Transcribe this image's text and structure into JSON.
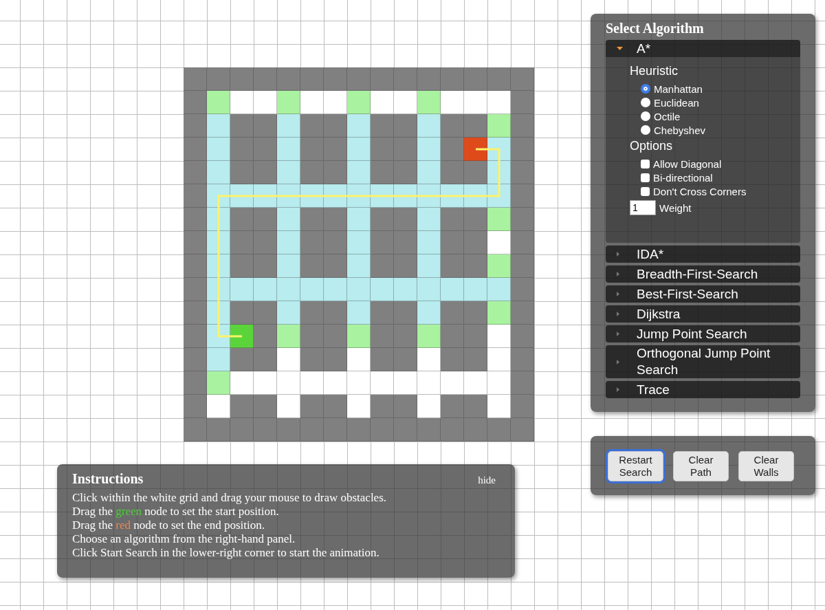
{
  "maze": {
    "rows": [
      [
        {
          "kind": "wall"
        },
        {
          "kind": "wall"
        },
        {
          "kind": "wall"
        },
        {
          "kind": "wall"
        },
        {
          "kind": "wall"
        },
        {
          "kind": "wall"
        },
        {
          "kind": "wall"
        },
        {
          "kind": "wall"
        },
        {
          "kind": "wall"
        },
        {
          "kind": "wall"
        },
        {
          "kind": "wall"
        },
        {
          "kind": "wall"
        },
        {
          "kind": "wall"
        },
        {
          "kind": "wall"
        },
        {
          "kind": "wall"
        }
      ],
      [
        {
          "kind": "wall"
        },
        {
          "kind": "open"
        },
        {
          "kind": "free"
        },
        {
          "kind": "free"
        },
        {
          "kind": "open"
        },
        {
          "kind": "free"
        },
        {
          "kind": "free"
        },
        {
          "kind": "open"
        },
        {
          "kind": "free"
        },
        {
          "kind": "free"
        },
        {
          "kind": "open"
        },
        {
          "kind": "free"
        },
        {
          "kind": "free"
        },
        {
          "kind": "free"
        },
        {
          "kind": "wall"
        }
      ],
      [
        {
          "kind": "wall"
        },
        {
          "kind": "closed"
        },
        {
          "kind": "wall"
        },
        {
          "kind": "wall"
        },
        {
          "kind": "closed"
        },
        {
          "kind": "wall"
        },
        {
          "kind": "wall"
        },
        {
          "kind": "closed"
        },
        {
          "kind": "wall"
        },
        {
          "kind": "wall"
        },
        {
          "kind": "closed"
        },
        {
          "kind": "wall"
        },
        {
          "kind": "wall"
        },
        {
          "kind": "open"
        },
        {
          "kind": "wall"
        }
      ],
      [
        {
          "kind": "wall"
        },
        {
          "kind": "closed"
        },
        {
          "kind": "wall"
        },
        {
          "kind": "wall"
        },
        {
          "kind": "closed"
        },
        {
          "kind": "wall"
        },
        {
          "kind": "wall"
        },
        {
          "kind": "closed"
        },
        {
          "kind": "wall"
        },
        {
          "kind": "wall"
        },
        {
          "kind": "closed"
        },
        {
          "kind": "wall"
        },
        {
          "kind": "end"
        },
        {
          "kind": "path"
        },
        {
          "kind": "wall"
        }
      ],
      [
        {
          "kind": "wall"
        },
        {
          "kind": "closed"
        },
        {
          "kind": "wall"
        },
        {
          "kind": "wall"
        },
        {
          "kind": "closed"
        },
        {
          "kind": "wall"
        },
        {
          "kind": "wall"
        },
        {
          "kind": "closed"
        },
        {
          "kind": "wall"
        },
        {
          "kind": "wall"
        },
        {
          "kind": "closed"
        },
        {
          "kind": "wall"
        },
        {
          "kind": "wall"
        },
        {
          "kind": "path"
        },
        {
          "kind": "wall"
        }
      ],
      [
        {
          "kind": "wall"
        },
        {
          "kind": "path"
        },
        {
          "kind": "path"
        },
        {
          "kind": "path"
        },
        {
          "kind": "path"
        },
        {
          "kind": "path"
        },
        {
          "kind": "path"
        },
        {
          "kind": "path"
        },
        {
          "kind": "path"
        },
        {
          "kind": "path"
        },
        {
          "kind": "path"
        },
        {
          "kind": "path"
        },
        {
          "kind": "path"
        },
        {
          "kind": "path"
        },
        {
          "kind": "wall"
        }
      ],
      [
        {
          "kind": "wall"
        },
        {
          "kind": "path"
        },
        {
          "kind": "wall"
        },
        {
          "kind": "wall"
        },
        {
          "kind": "closed"
        },
        {
          "kind": "wall"
        },
        {
          "kind": "wall"
        },
        {
          "kind": "closed"
        },
        {
          "kind": "wall"
        },
        {
          "kind": "wall"
        },
        {
          "kind": "closed"
        },
        {
          "kind": "wall"
        },
        {
          "kind": "wall"
        },
        {
          "kind": "open"
        },
        {
          "kind": "wall"
        }
      ],
      [
        {
          "kind": "wall"
        },
        {
          "kind": "path"
        },
        {
          "kind": "wall"
        },
        {
          "kind": "wall"
        },
        {
          "kind": "closed"
        },
        {
          "kind": "wall"
        },
        {
          "kind": "wall"
        },
        {
          "kind": "closed"
        },
        {
          "kind": "wall"
        },
        {
          "kind": "wall"
        },
        {
          "kind": "closed"
        },
        {
          "kind": "wall"
        },
        {
          "kind": "wall"
        },
        {
          "kind": "free"
        },
        {
          "kind": "wall"
        }
      ],
      [
        {
          "kind": "wall"
        },
        {
          "kind": "path"
        },
        {
          "kind": "wall"
        },
        {
          "kind": "wall"
        },
        {
          "kind": "closed"
        },
        {
          "kind": "wall"
        },
        {
          "kind": "wall"
        },
        {
          "kind": "closed"
        },
        {
          "kind": "wall"
        },
        {
          "kind": "wall"
        },
        {
          "kind": "closed"
        },
        {
          "kind": "wall"
        },
        {
          "kind": "wall"
        },
        {
          "kind": "open"
        },
        {
          "kind": "wall"
        }
      ],
      [
        {
          "kind": "wall"
        },
        {
          "kind": "path"
        },
        {
          "kind": "closed"
        },
        {
          "kind": "closed"
        },
        {
          "kind": "closed"
        },
        {
          "kind": "closed"
        },
        {
          "kind": "closed"
        },
        {
          "kind": "closed"
        },
        {
          "kind": "closed"
        },
        {
          "kind": "closed"
        },
        {
          "kind": "closed"
        },
        {
          "kind": "closed"
        },
        {
          "kind": "closed"
        },
        {
          "kind": "closed"
        },
        {
          "kind": "wall"
        }
      ],
      [
        {
          "kind": "wall"
        },
        {
          "kind": "path"
        },
        {
          "kind": "wall"
        },
        {
          "kind": "wall"
        },
        {
          "kind": "closed"
        },
        {
          "kind": "wall"
        },
        {
          "kind": "wall"
        },
        {
          "kind": "closed"
        },
        {
          "kind": "wall"
        },
        {
          "kind": "wall"
        },
        {
          "kind": "closed"
        },
        {
          "kind": "wall"
        },
        {
          "kind": "wall"
        },
        {
          "kind": "open"
        },
        {
          "kind": "wall"
        }
      ],
      [
        {
          "kind": "wall"
        },
        {
          "kind": "path"
        },
        {
          "kind": "start"
        },
        {
          "kind": "wall"
        },
        {
          "kind": "open"
        },
        {
          "kind": "wall"
        },
        {
          "kind": "wall"
        },
        {
          "kind": "open"
        },
        {
          "kind": "wall"
        },
        {
          "kind": "wall"
        },
        {
          "kind": "open"
        },
        {
          "kind": "wall"
        },
        {
          "kind": "wall"
        },
        {
          "kind": "free"
        },
        {
          "kind": "wall"
        }
      ],
      [
        {
          "kind": "wall"
        },
        {
          "kind": "closed"
        },
        {
          "kind": "wall"
        },
        {
          "kind": "wall"
        },
        {
          "kind": "free"
        },
        {
          "kind": "wall"
        },
        {
          "kind": "wall"
        },
        {
          "kind": "free"
        },
        {
          "kind": "wall"
        },
        {
          "kind": "wall"
        },
        {
          "kind": "free"
        },
        {
          "kind": "wall"
        },
        {
          "kind": "wall"
        },
        {
          "kind": "free"
        },
        {
          "kind": "wall"
        }
      ],
      [
        {
          "kind": "wall"
        },
        {
          "kind": "open"
        },
        {
          "kind": "free"
        },
        {
          "kind": "free"
        },
        {
          "kind": "free"
        },
        {
          "kind": "free"
        },
        {
          "kind": "free"
        },
        {
          "kind": "free"
        },
        {
          "kind": "free"
        },
        {
          "kind": "free"
        },
        {
          "kind": "free"
        },
        {
          "kind": "free"
        },
        {
          "kind": "free"
        },
        {
          "kind": "free"
        },
        {
          "kind": "wall"
        }
      ],
      [
        {
          "kind": "wall"
        },
        {
          "kind": "free"
        },
        {
          "kind": "wall"
        },
        {
          "kind": "wall"
        },
        {
          "kind": "free"
        },
        {
          "kind": "wall"
        },
        {
          "kind": "wall"
        },
        {
          "kind": "free"
        },
        {
          "kind": "wall"
        },
        {
          "kind": "wall"
        },
        {
          "kind": "free"
        },
        {
          "kind": "wall"
        },
        {
          "kind": "wall"
        },
        {
          "kind": "free"
        },
        {
          "kind": "wall"
        }
      ],
      [
        {
          "kind": "wall"
        },
        {
          "kind": "wall"
        },
        {
          "kind": "wall"
        },
        {
          "kind": "wall"
        },
        {
          "kind": "wall"
        },
        {
          "kind": "wall"
        },
        {
          "kind": "wall"
        },
        {
          "kind": "wall"
        },
        {
          "kind": "wall"
        },
        {
          "kind": "wall"
        },
        {
          "kind": "wall"
        },
        {
          "kind": "wall"
        },
        {
          "kind": "wall"
        },
        {
          "kind": "wall"
        },
        {
          "kind": "wall"
        }
      ]
    ]
  },
  "algorithm_panel": {
    "title": "Select Algorithm",
    "algorithms": [
      {
        "name": "A*",
        "expanded": true,
        "heuristic_label": "Heuristic",
        "heuristics": [
          {
            "label": "Manhattan",
            "selected": true
          },
          {
            "label": "Euclidean",
            "selected": false
          },
          {
            "label": "Octile",
            "selected": false
          },
          {
            "label": "Chebyshev",
            "selected": false
          }
        ],
        "options_label": "Options",
        "options": [
          {
            "label": "Allow Diagonal",
            "checked": false
          },
          {
            "label": "Bi-directional",
            "checked": false
          },
          {
            "label": "Don't Cross Corners",
            "checked": false
          }
        ],
        "weight": {
          "value": "1",
          "label": "Weight"
        }
      },
      {
        "name": "IDA*",
        "expanded": false
      },
      {
        "name": "Breadth-First-Search",
        "expanded": false
      },
      {
        "name": "Best-First-Search",
        "expanded": false
      },
      {
        "name": "Dijkstra",
        "expanded": false
      },
      {
        "name": "Jump Point Search",
        "expanded": false
      },
      {
        "name": "Orthogonal Jump Point Search",
        "expanded": false
      },
      {
        "name": "Trace",
        "expanded": false
      }
    ]
  },
  "control_buttons": [
    {
      "label": "Restart Search",
      "focused": true
    },
    {
      "label": "Clear Path",
      "focused": false
    },
    {
      "label": "Clear Walls",
      "focused": false
    }
  ],
  "instructions": {
    "title": "Instructions",
    "hide_link": "hide",
    "lines": [
      {
        "parts": [
          {
            "text": "Click within the white grid and drag your mouse to draw obstacles."
          }
        ]
      },
      {
        "parts": [
          {
            "text": "Drag the "
          },
          {
            "text": "green",
            "color": "#4fd13a"
          },
          {
            "text": " node to set the start position."
          }
        ]
      },
      {
        "parts": [
          {
            "text": "Drag the "
          },
          {
            "text": "red",
            "color": "#e8875a"
          },
          {
            "text": " node to set the end position."
          }
        ]
      },
      {
        "parts": [
          {
            "text": "Choose an algorithm from the right-hand panel."
          }
        ]
      },
      {
        "parts": [
          {
            "text": "Click Start Search in the lower-right corner to start the animation."
          }
        ]
      }
    ]
  }
}
